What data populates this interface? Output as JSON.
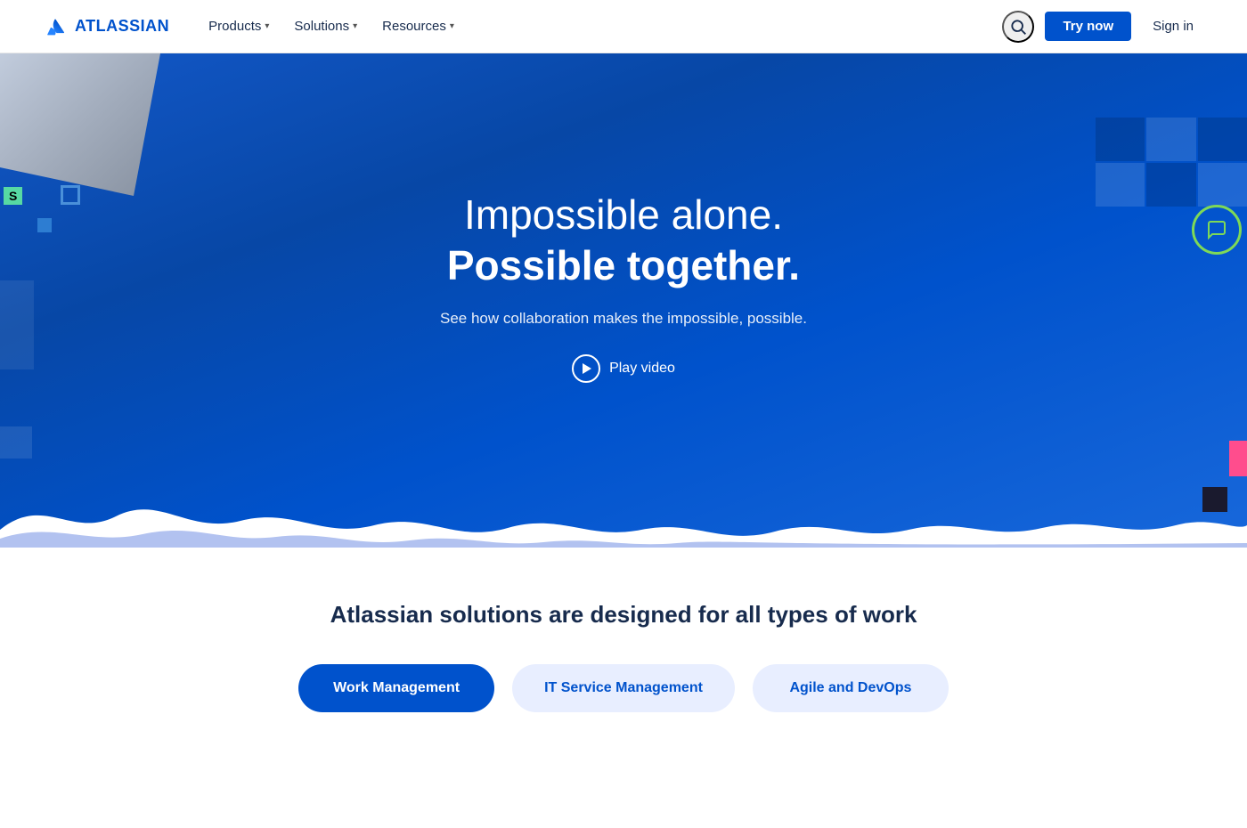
{
  "navbar": {
    "logo_text": "ATLASSIAN",
    "nav_items": [
      {
        "label": "Products",
        "has_dropdown": true
      },
      {
        "label": "Solutions",
        "has_dropdown": true
      },
      {
        "label": "Resources",
        "has_dropdown": true
      }
    ],
    "try_now_label": "Try now",
    "sign_in_label": "Sign in"
  },
  "hero": {
    "headline_light": "Impossible alone.",
    "headline_bold": "Possible together.",
    "subtext": "See how collaboration makes the impossible, possible.",
    "play_label": "Play video"
  },
  "solutions": {
    "title": "Atlassian solutions are designed for all types of work",
    "buttons": [
      {
        "label": "Work Management",
        "active": true
      },
      {
        "label": "IT Service Management",
        "active": false
      },
      {
        "label": "Agile and DevOps",
        "active": false
      }
    ]
  }
}
